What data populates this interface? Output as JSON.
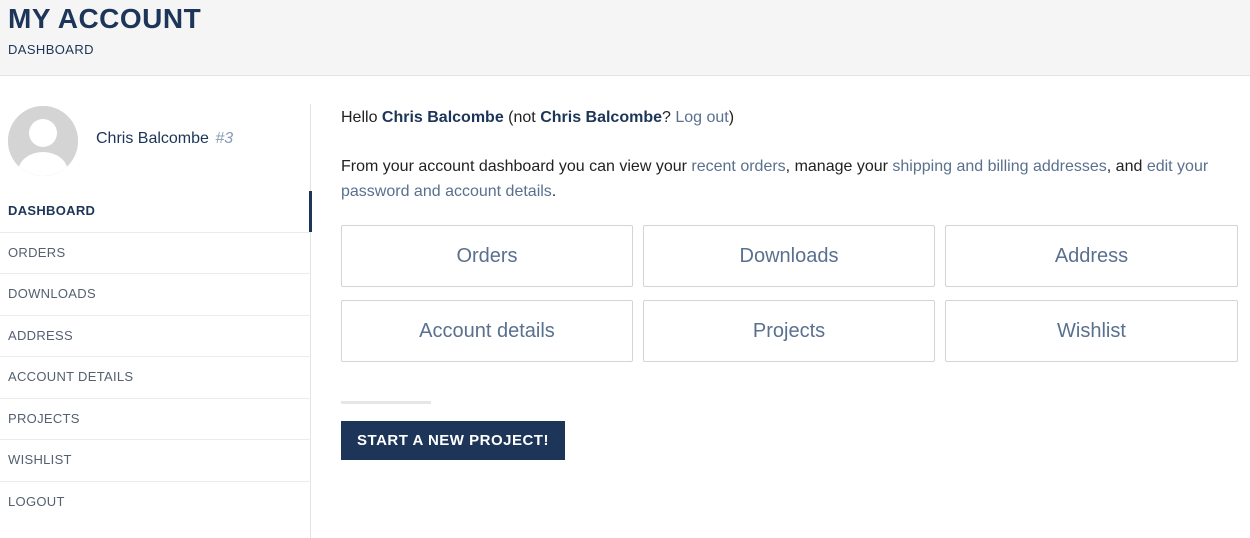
{
  "header": {
    "title": "MY ACCOUNT",
    "breadcrumb": "DASHBOARD"
  },
  "user": {
    "name": "Chris Balcombe",
    "id": "#3"
  },
  "sidebar": {
    "items": [
      {
        "label": "DASHBOARD",
        "active": true
      },
      {
        "label": "ORDERS"
      },
      {
        "label": "DOWNLOADS"
      },
      {
        "label": "ADDRESS"
      },
      {
        "label": "ACCOUNT DETAILS"
      },
      {
        "label": "PROJECTS"
      },
      {
        "label": "WISHLIST"
      },
      {
        "label": "LOGOUT"
      }
    ]
  },
  "main": {
    "hello": {
      "prefix": "Hello ",
      "name": "Chris Balcombe",
      "not": " (not ",
      "name2": "Chris Balcombe",
      "q": "? ",
      "logout": "Log out",
      "close": ")"
    },
    "intro": {
      "t1": "From your account dashboard you can view your ",
      "l1": "recent orders",
      "t2": ", manage your ",
      "l2": "shipping and billing addresses",
      "t3": ", and ",
      "l3": "edit your password and account details",
      "t4": "."
    },
    "tiles": [
      "Orders",
      "Downloads",
      "Address",
      "Account details",
      "Projects",
      "Wishlist"
    ],
    "cta": "START A NEW PROJECT!"
  },
  "colors": {
    "brand_navy": "#1c3558",
    "link": "#59708f",
    "muted": "#8a9bb3"
  }
}
